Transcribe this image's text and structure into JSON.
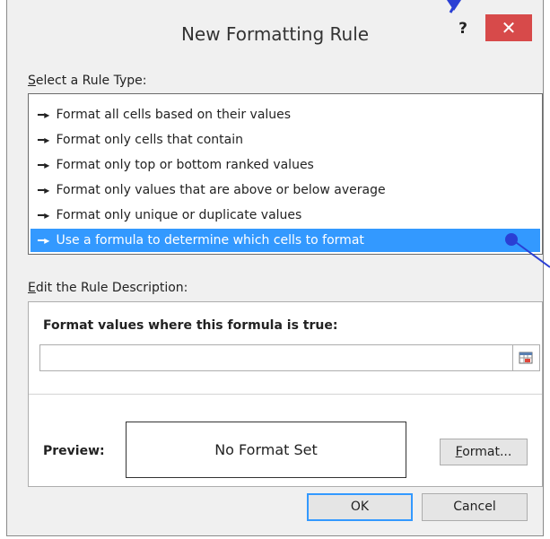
{
  "window": {
    "title": "New Formatting Rule",
    "help_label": "?",
    "close_label": "✕"
  },
  "rule_type": {
    "label": "Select a Rule Type:",
    "items": [
      {
        "label": "Format all cells based on their values",
        "selected": false
      },
      {
        "label": "Format only cells that contain",
        "selected": false
      },
      {
        "label": "Format only top or bottom ranked values",
        "selected": false
      },
      {
        "label": "Format only values that are above or below average",
        "selected": false
      },
      {
        "label": "Format only unique or duplicate values",
        "selected": false
      },
      {
        "label": "Use a formula to determine which cells to format",
        "selected": true
      }
    ],
    "arrow_glyph": "➤"
  },
  "description": {
    "label": "Edit the Rule Description:",
    "formula_label": "Format values where this formula is true:",
    "formula_value": "",
    "preview_label": "Preview:",
    "preview_text": "No Format Set",
    "format_button": "Format..."
  },
  "footer": {
    "ok_label": "OK",
    "cancel_label": "Cancel"
  },
  "colors": {
    "selection": "#3399ff",
    "close_button": "#d74a4a",
    "annotation": "#2a3fd4"
  },
  "icons": {
    "ref_button": "range-select-icon",
    "list_arrow": "arrow-right-icon"
  }
}
